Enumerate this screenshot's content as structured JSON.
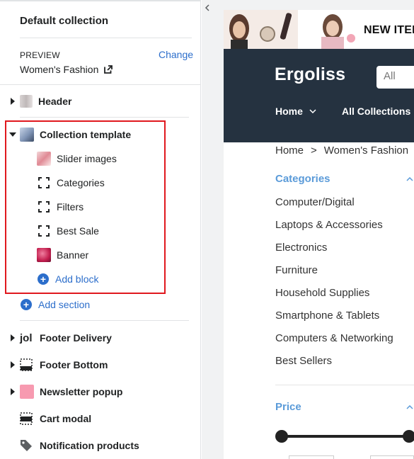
{
  "sidebar": {
    "collection_title": "Default collection",
    "preview_label": "PREVIEW",
    "change_label": "Change",
    "preview_value": "Women's Fashion",
    "sections": {
      "header": "Header",
      "collection_template": "Collection template",
      "footer_delivery": "Footer Delivery",
      "footer_bottom": "Footer Bottom",
      "newsletter_popup": "Newsletter popup",
      "cart_modal": "Cart modal",
      "notification_products": "Notification products"
    },
    "blocks": {
      "slider_images": "Slider images",
      "categories": "Categories",
      "filters": "Filters",
      "best_sale": "Best Sale",
      "banner": "Banner"
    },
    "add_block": "Add block",
    "add_section": "Add section",
    "footer_delivery_icon_text": "jol"
  },
  "preview": {
    "promo_text": "NEW ITEM",
    "logo": "Ergoliss",
    "search_placeholder": "All",
    "nav": {
      "home": "Home",
      "all_collections": "All Collections"
    },
    "breadcrumb": {
      "home": "Home",
      "separator": ">",
      "current": "Women's Fashion"
    },
    "categories_title": "Categories",
    "categories": [
      "Computer/Digital",
      "Laptops & Accessories",
      "Electronics",
      "Furniture",
      "Household Supplies",
      "Smartphone & Tablets",
      "Computers & Networking",
      "Best Sellers"
    ],
    "price_title": "Price"
  },
  "colors": {
    "accent_blue": "#2c6ecb",
    "highlight_red": "#e0181e",
    "store_bar": "#253240",
    "section_title_blue": "#5b9bd9"
  }
}
